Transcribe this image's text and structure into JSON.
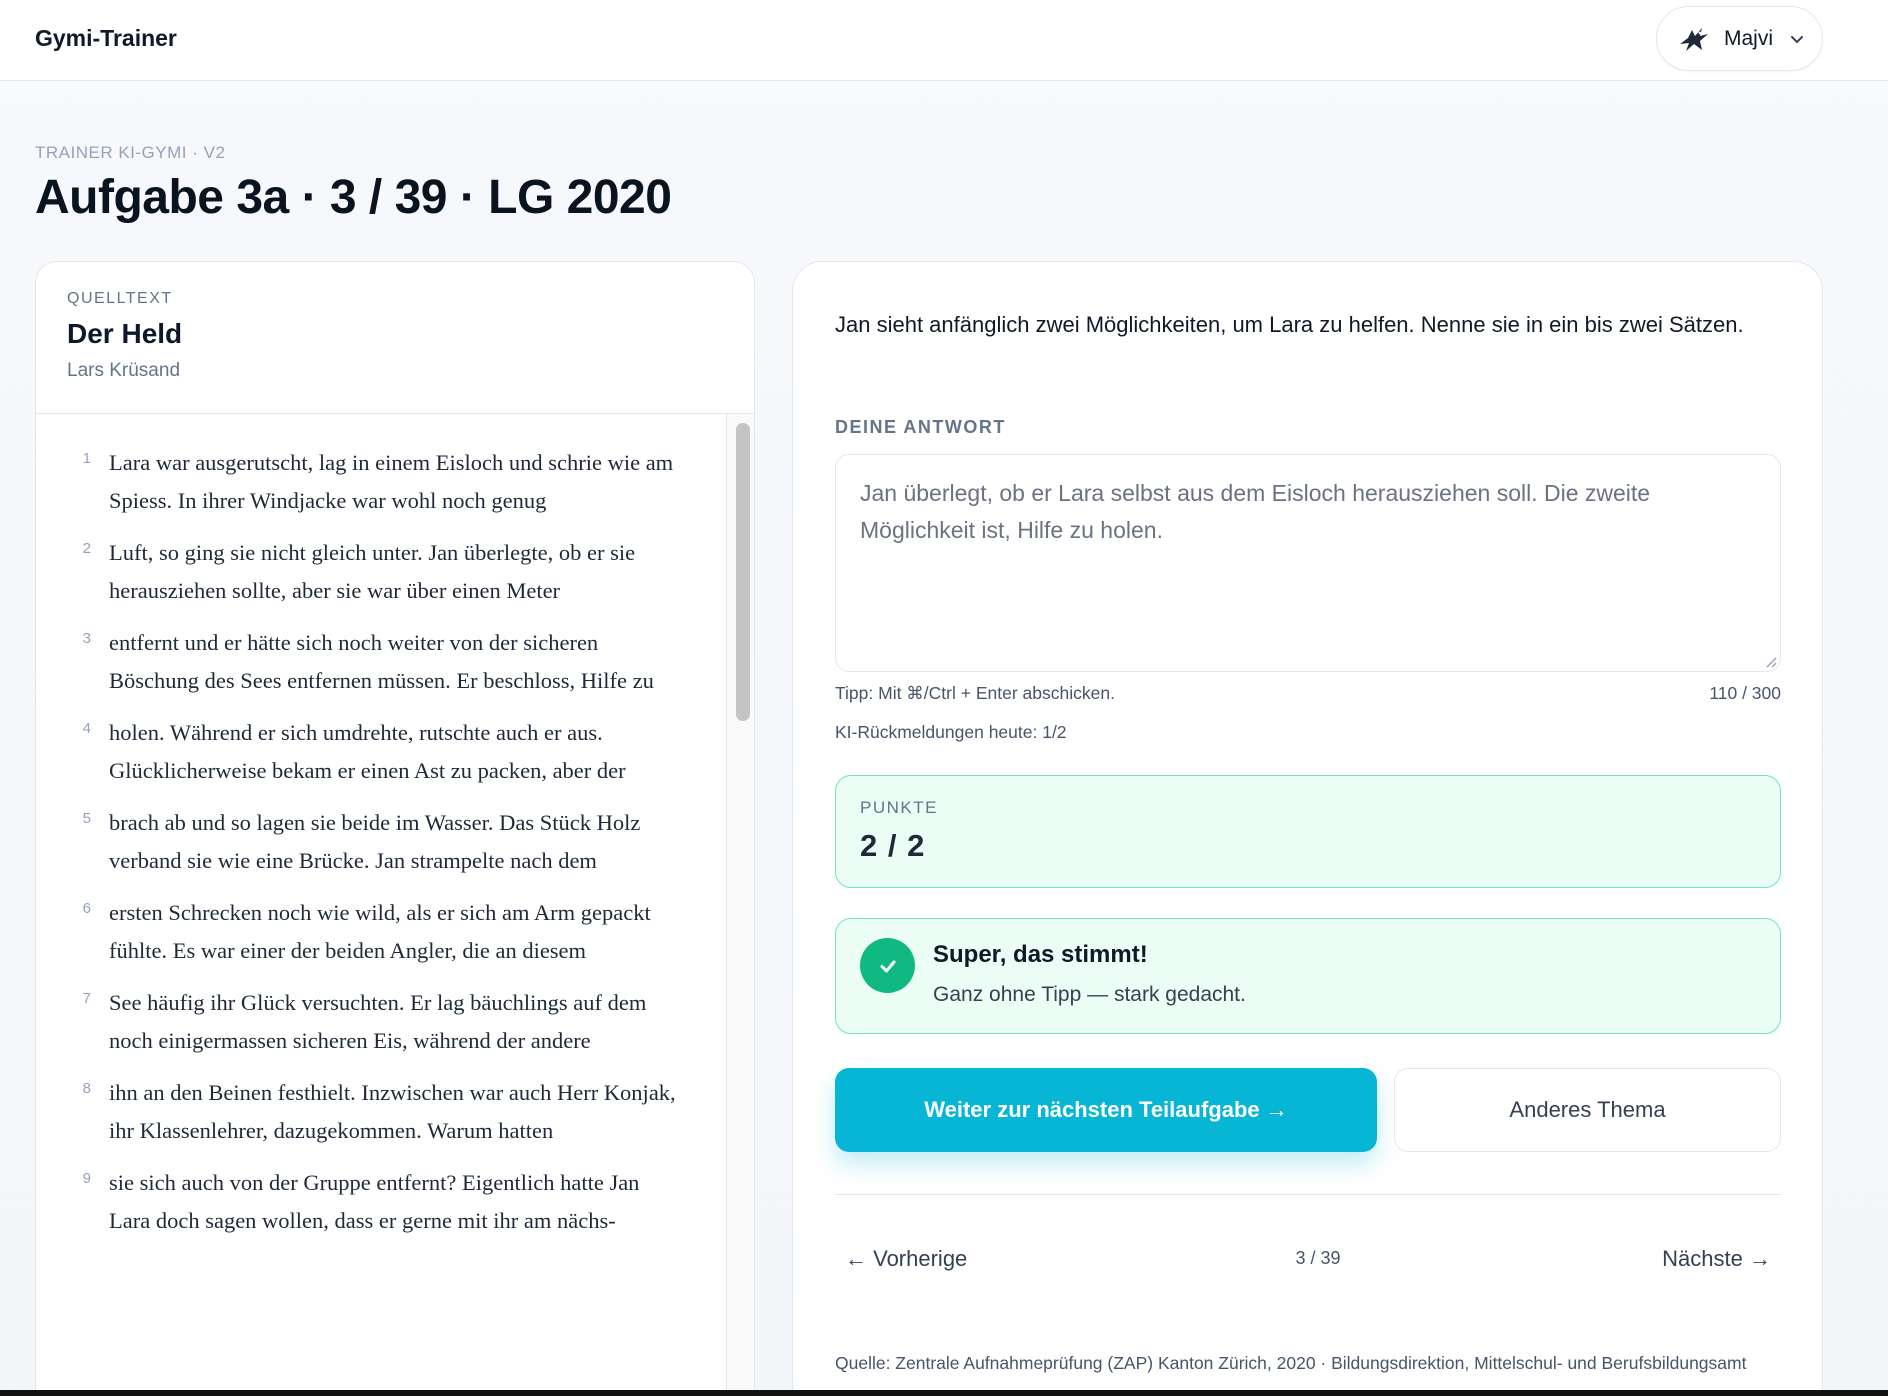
{
  "header": {
    "brand": "Gymi-Trainer",
    "user_name": "Majvi",
    "avatar_icon": "bird-icon",
    "menu_icon": "chevron-down-icon"
  },
  "page": {
    "eyebrow": "TRAINER KI-GYMI · V2",
    "title": "Aufgabe 3a · 3 / 39 · LG 2020"
  },
  "source_text": {
    "label": "QUELLTEXT",
    "title": "Der Held",
    "author": "Lars Krüsand",
    "lines": [
      {
        "num": "1",
        "text": "Lara war ausgerutscht, lag in einem Eisloch und schrie wie am Spiess. In ihrer Windjacke war wohl noch genug"
      },
      {
        "num": "2",
        "text": "Luft, so ging sie nicht gleich unter. Jan überlegte, ob er sie herausziehen sollte, aber sie war über einen Meter"
      },
      {
        "num": "3",
        "text": "entfernt und er hätte sich noch weiter von der sicheren Böschung des Sees entfernen müssen. Er beschloss, Hilfe zu"
      },
      {
        "num": "4",
        "text": "holen. Während er sich umdrehte, rutschte auch er aus. Glücklicherweise bekam er einen Ast zu packen, aber der"
      },
      {
        "num": "5",
        "text": "brach ab und so lagen sie beide im Wasser. Das Stück Holz verband sie wie eine Brücke. Jan strampelte nach dem"
      },
      {
        "num": "6",
        "text": "ersten Schrecken noch wie wild, als er sich am Arm gepackt fühlte. Es war einer der beiden Angler, die an diesem"
      },
      {
        "num": "7",
        "text": "See häufig ihr Glück versuchten. Er lag bäuchlings auf dem noch einigermassen sicheren Eis, während der andere"
      },
      {
        "num": "8",
        "text": "ihn an den Beinen festhielt. Inzwischen war auch Herr Konjak, ihr Klassenlehrer, dazugekommen. Warum hatten"
      },
      {
        "num": "9",
        "text": "sie sich auch von der Gruppe entfernt? Eigentlich hatte Jan Lara doch sagen wollen, dass er gerne mit ihr am nächs-"
      }
    ]
  },
  "task": {
    "question": "Jan sieht anfänglich zwei Möglichkeiten, um Lara zu helfen. Nenne sie in ein bis zwei Sätzen.",
    "answer_label": "DEINE ANTWORT",
    "answer_value": "Jan überlegt, ob er Lara selbst aus dem Eisloch herausziehen soll. Die zweite Möglichkeit ist, Hilfe zu holen.",
    "tip": "Tipp: Mit ⌘/Ctrl + Enter abschicken.",
    "char_count": "110 / 300",
    "quota": "KI-Rückmeldungen heute: 1/2",
    "points_label": "PUNKTE",
    "points_value": "2 / 2",
    "feedback_title": "Super, das stimmt!",
    "feedback_text": "Ganz ohne Tipp — stark gedacht.",
    "next_button": "Weiter zur nächsten Teilaufgabe →",
    "other_button": "Anderes Thema",
    "prev_label": "← Vorherige",
    "page_indicator": "3 / 39",
    "next_label": "Nächste →",
    "source": "Quelle: Zentrale Aufnahmeprüfung (ZAP) Kanton Zürich, 2020 · Bildungsdirektion, Mittelschul- und Berufsbildungsamt"
  },
  "colors": {
    "accent": "#06b6d4",
    "success_bg": "#ecfdf5",
    "success_border": "#6ee7b7",
    "success_icon": "#10b981"
  }
}
